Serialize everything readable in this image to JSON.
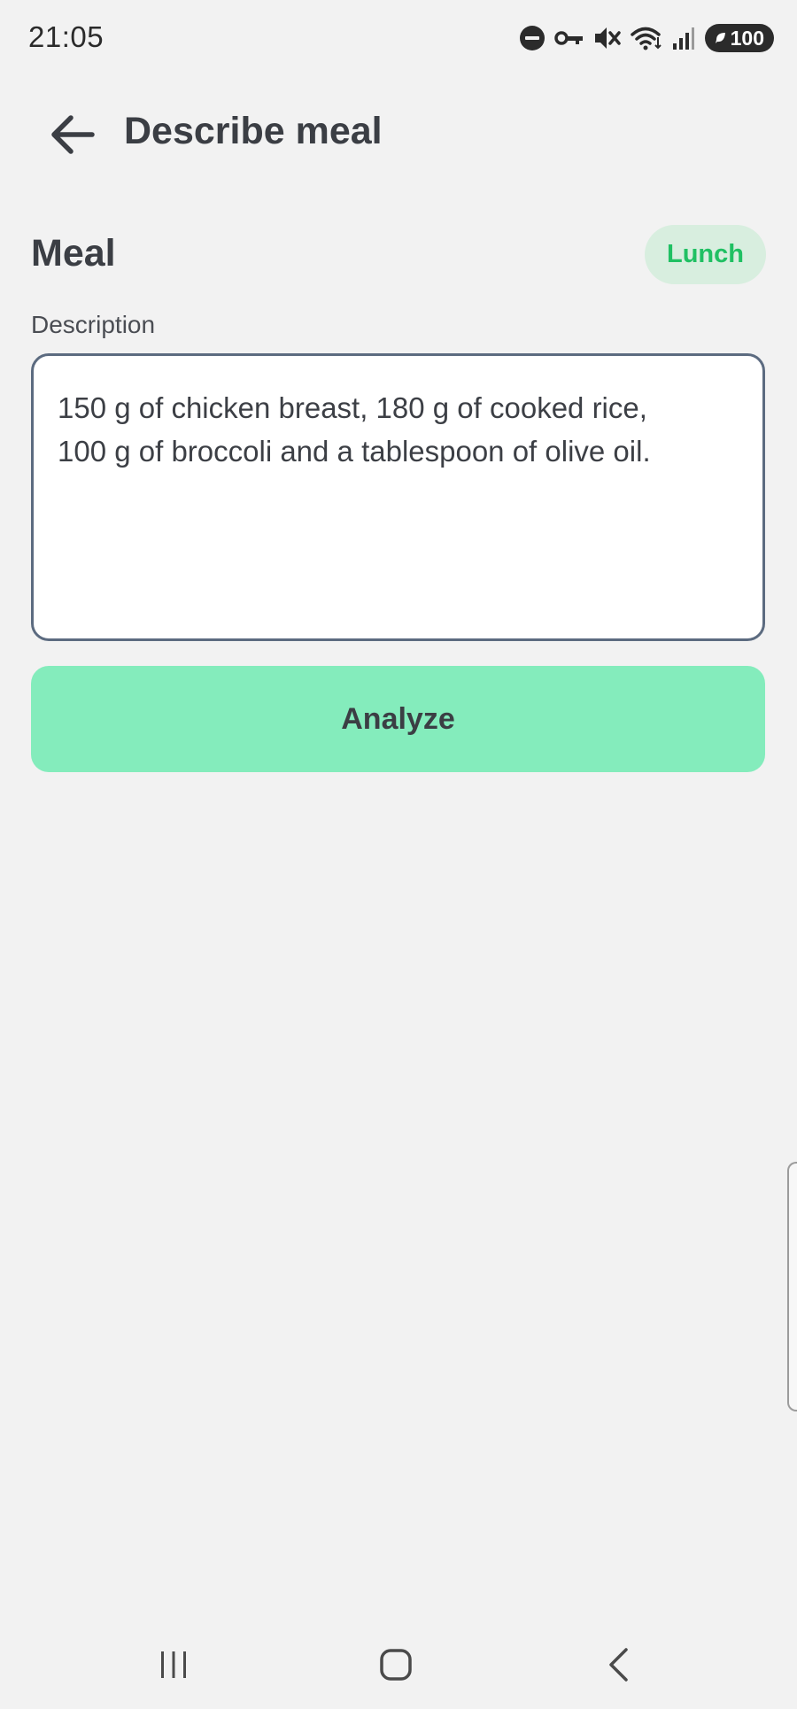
{
  "status_bar": {
    "time": "21:05",
    "icons": [
      "do-not-disturb-icon",
      "vpn-key-icon",
      "mute-icon",
      "wifi-icon",
      "signal-icon"
    ],
    "battery_level": "100"
  },
  "app_bar": {
    "title": "Describe meal",
    "back_icon": "arrow-back-icon"
  },
  "meal": {
    "heading": "Meal",
    "meal_type": "Lunch",
    "chip_color": "#20c063"
  },
  "description": {
    "label": "Description",
    "value": "150 g of chicken breast, 180 g of cooked rice,\n100 g of broccoli and a tablespoon of olive oil."
  },
  "actions": {
    "analyze_label": "Analyze",
    "button_color": "#84ecbc"
  },
  "nav_bar": {
    "icons": [
      "recent-apps-icon",
      "home-icon",
      "back-icon"
    ]
  }
}
